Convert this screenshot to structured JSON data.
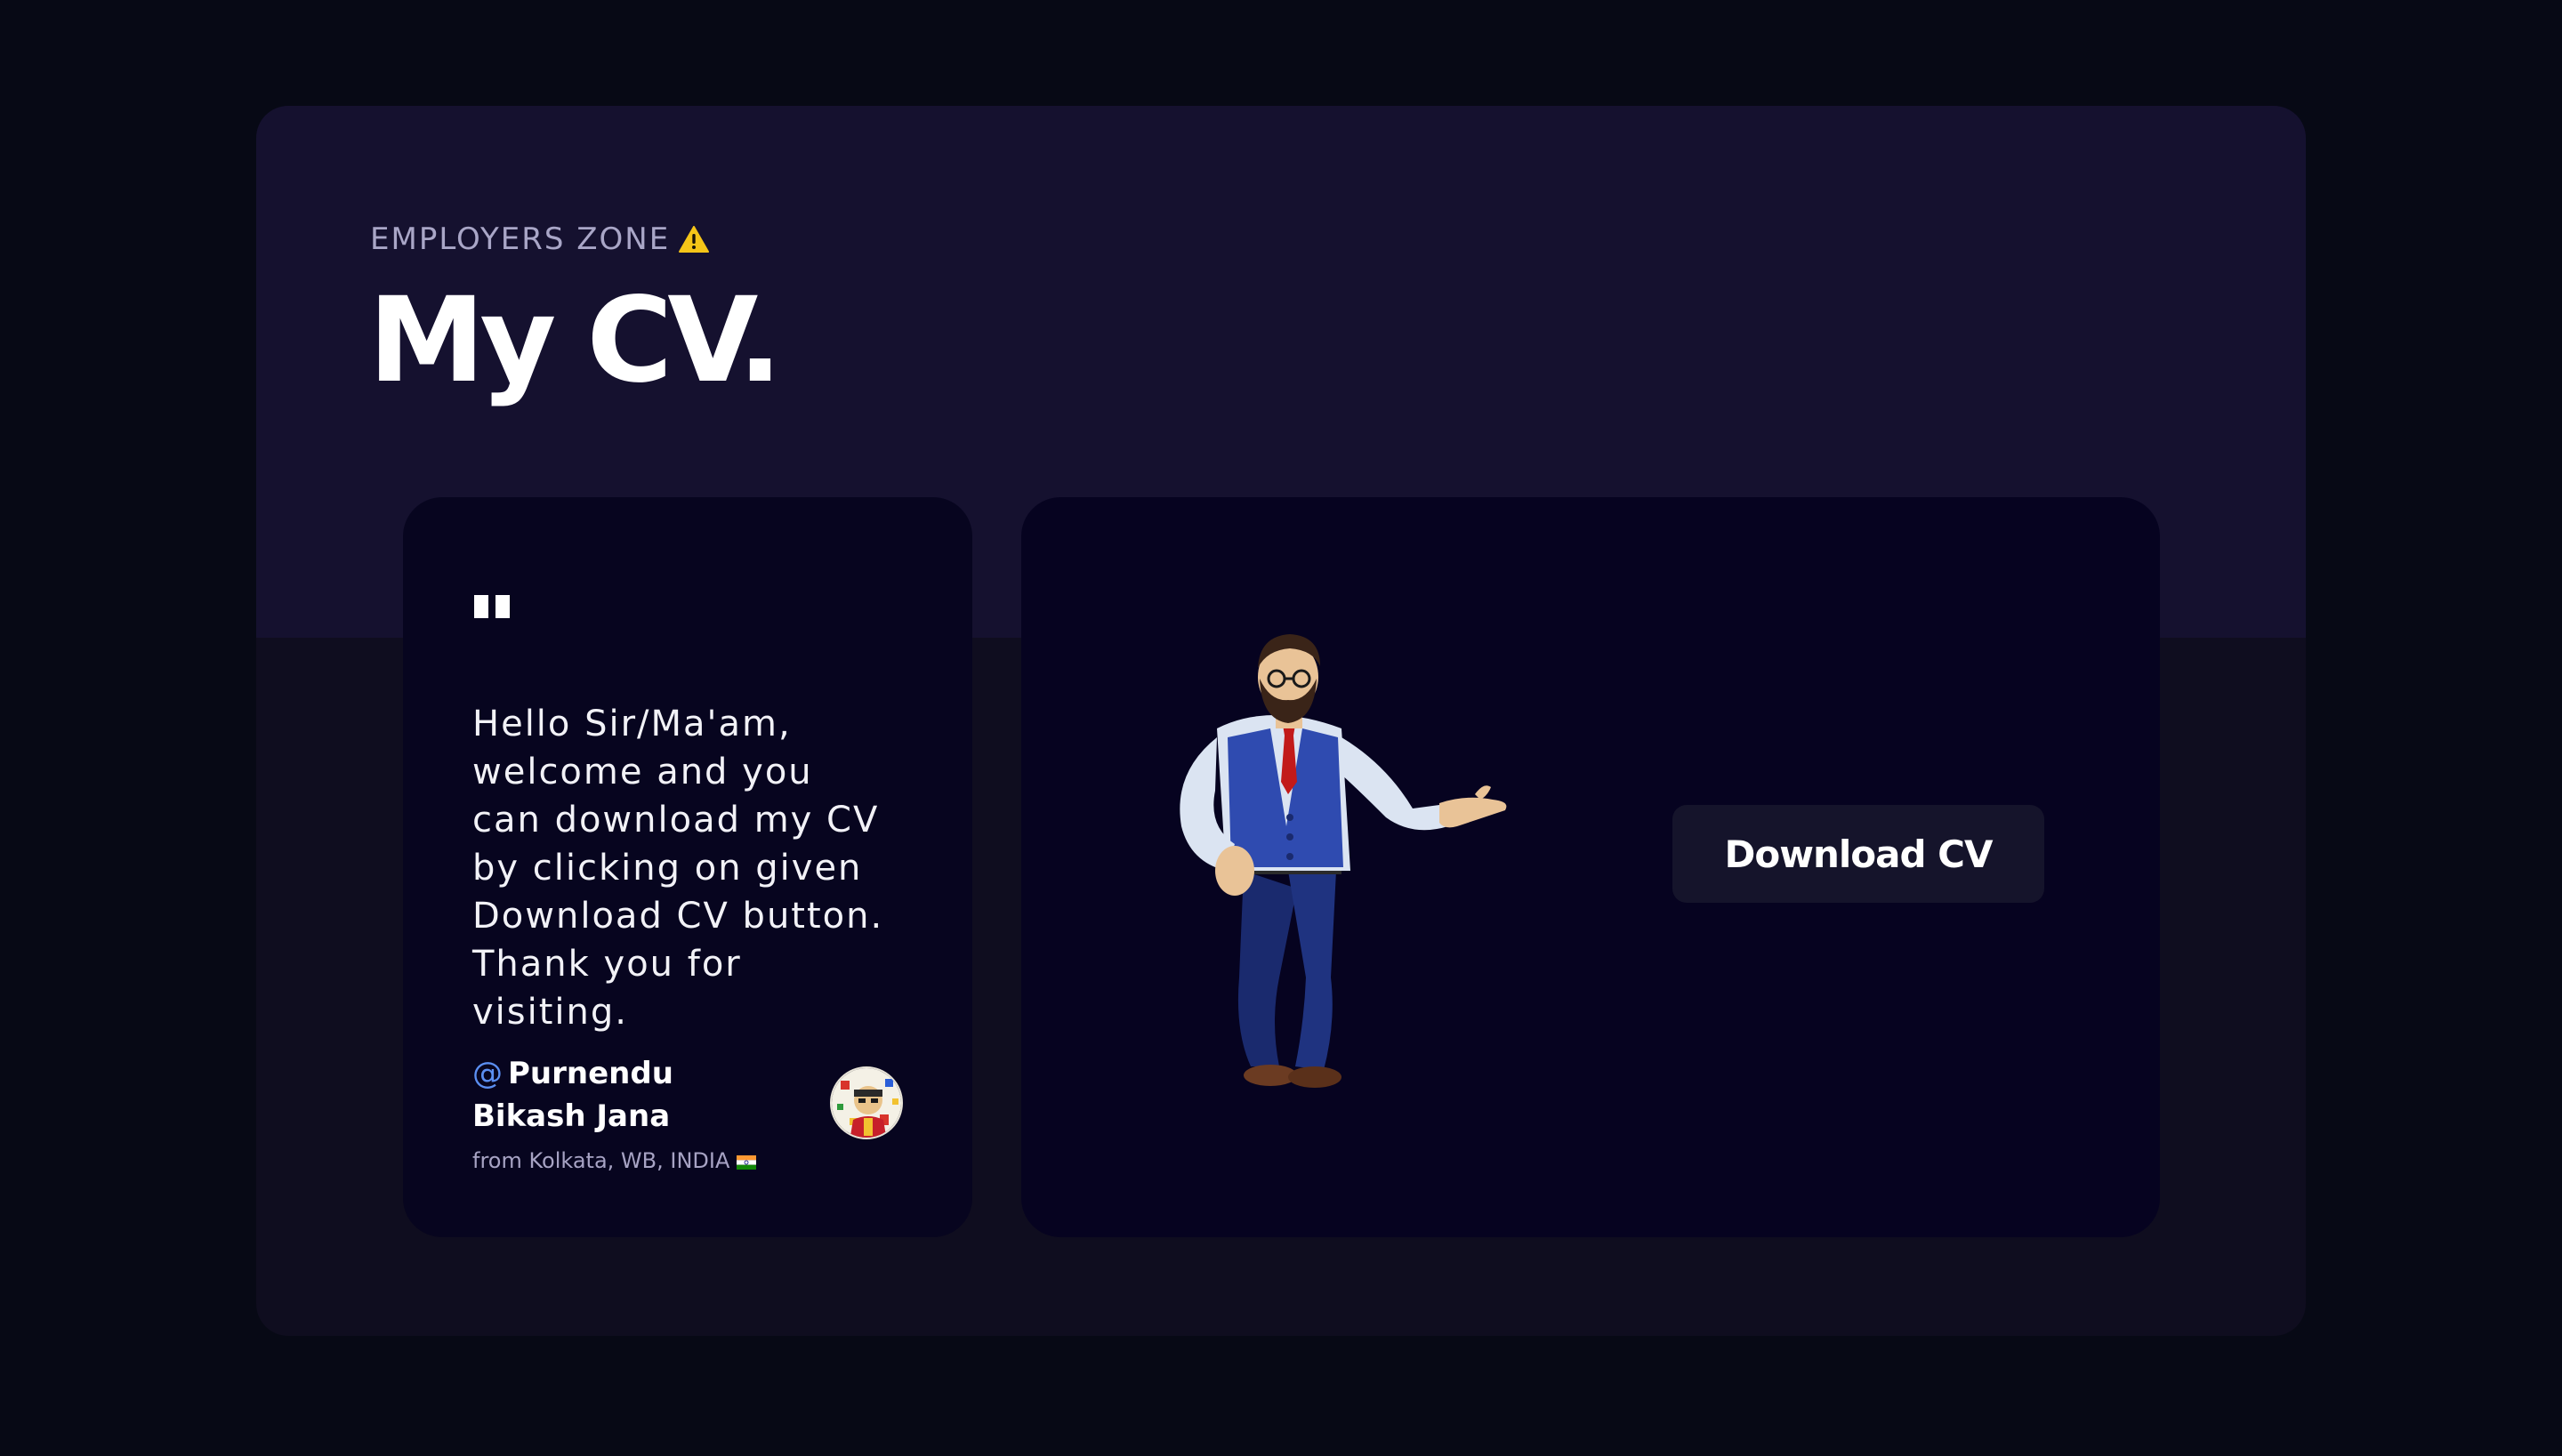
{
  "header": {
    "subtitle": "EMPLOYERS ZONE",
    "subtitle_icon": "warning-icon",
    "title": "My CV."
  },
  "quote_card": {
    "quote_icon": "quote-icon",
    "message": "Hello Sir/Ma'am, welcome and you can download my CV by clicking on given Download CV button. Thank you for visiting.",
    "author_prefix": "@",
    "author_name": "Purnendu Bikash Jana",
    "location": "from Kolkata, WB, INDIA",
    "location_icon": "india-flag-icon",
    "avatar_icon": "avatar"
  },
  "cv_card": {
    "illustration": "presenter-character-illustration",
    "download_label": "Download CV"
  },
  "colors": {
    "page_bg": "#070915",
    "outer_card": "#15112f",
    "inner_card": "#07051f",
    "button_bg": "#15142b",
    "accent": "#5b8ff2",
    "warning": "#f5c518"
  }
}
